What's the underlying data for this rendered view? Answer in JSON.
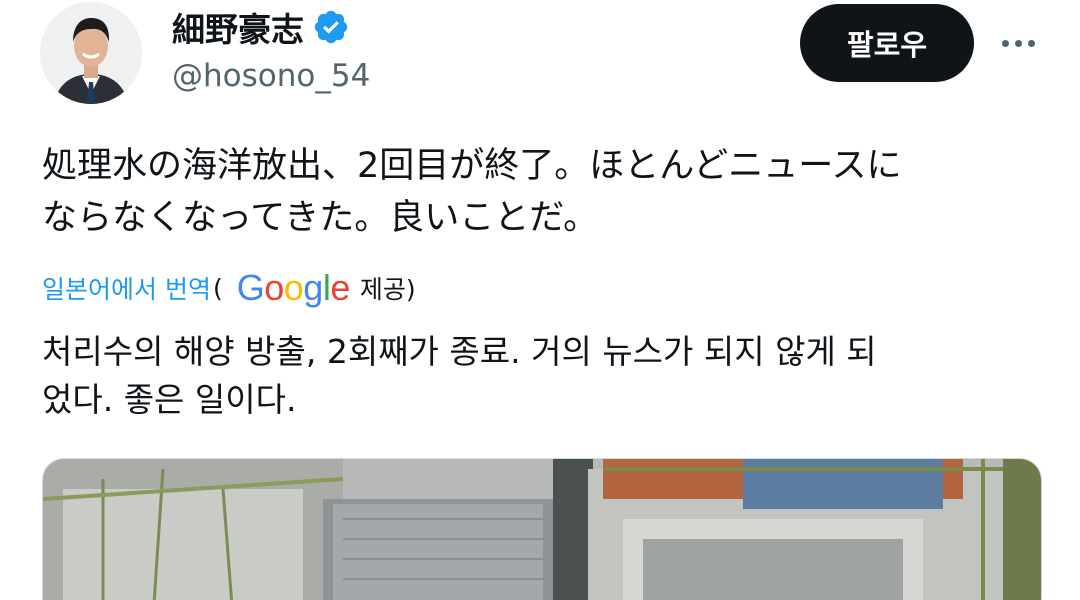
{
  "author": {
    "display_name": "細野豪志",
    "handle": "@hosono_54",
    "verified_icon": "verified-badge-icon",
    "avatar_icon": "avatar"
  },
  "actions": {
    "follow_label": "팔로우",
    "more_icon": "more-icon"
  },
  "tweet": {
    "text": "処理水の海洋放出、2回目が終了。ほとんどニュースに\nならなくなってきた。良いことだ。"
  },
  "translation": {
    "link_label": "일본어에서 번역",
    "open_paren": "(",
    "provider_logo_text": "Google",
    "provided_label": "제공)",
    "text": "처리수의 해양 방출, 2회째가 종료. 거의 뉴스가 되지 않게 되\n었다. 좋은 일이다."
  },
  "colors": {
    "link": "#1d9bf0",
    "text": "#0f1419",
    "secondary": "#536471",
    "button_bg": "#0f1419",
    "verified": "#1d9bf0"
  }
}
